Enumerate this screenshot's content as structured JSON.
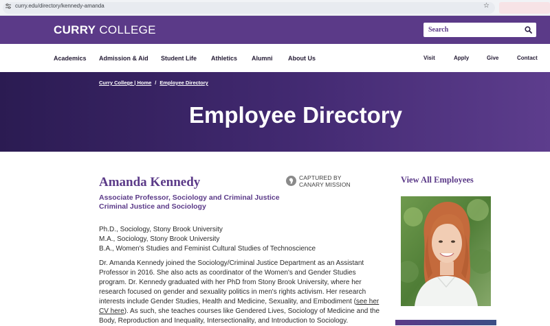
{
  "browser": {
    "url": "curry.edu/directory/kennedy-amanda"
  },
  "header": {
    "logo_bold": "CURRY",
    "logo_light": "COLLEGE",
    "search_placeholder": "Search"
  },
  "nav": {
    "items": [
      "Academics",
      "Admission & Aid",
      "Student Life",
      "Athletics",
      "Alumni",
      "About Us"
    ],
    "utility": [
      "Visit",
      "Apply",
      "Give",
      "Contact"
    ]
  },
  "hero": {
    "breadcrumb": [
      "Curry College | Home",
      "Employee Directory"
    ],
    "separator": "/",
    "title": "Employee Directory"
  },
  "profile": {
    "name": "Amanda Kennedy",
    "titles": [
      "Associate Professor, Sociology and Criminal Justice",
      "Criminal Justice and Sociology"
    ],
    "degrees": [
      "Ph.D., Sociology, Stony Brook University",
      "M.A., Sociology, Stony Brook University",
      "B.A., Women's Studies and Feminist Cultural Studies of Technoscience"
    ],
    "bio_before_link": "Dr. Amanda Kennedy joined the Sociology/Criminal Justice Department as an Assistant Professor in 2016. She also acts as coordinator of the Women's and Gender Studies program. Dr. Kennedy graduated with her PhD from Stony Brook University, where her research focused on gender and sexuality politics in men's rights activism. Her research interests include Gender Studies, Health and Medicine, Sexuality, and Embodiment (",
    "bio_link": "see her CV here",
    "bio_after_link": "). As such, she teaches courses like Gendered Lives, Sociology of Medicine and the Body, Reproduction and Inequality, Intersectionality, and Introduction to Sociology."
  },
  "badge": {
    "line1": "CAPTURED BY",
    "line2": "CANARY MISSION"
  },
  "sidebar": {
    "view_all": "View All Employees"
  },
  "colors": {
    "brand_purple": "#5b3a88",
    "hero_dark": "#2b1b52"
  }
}
